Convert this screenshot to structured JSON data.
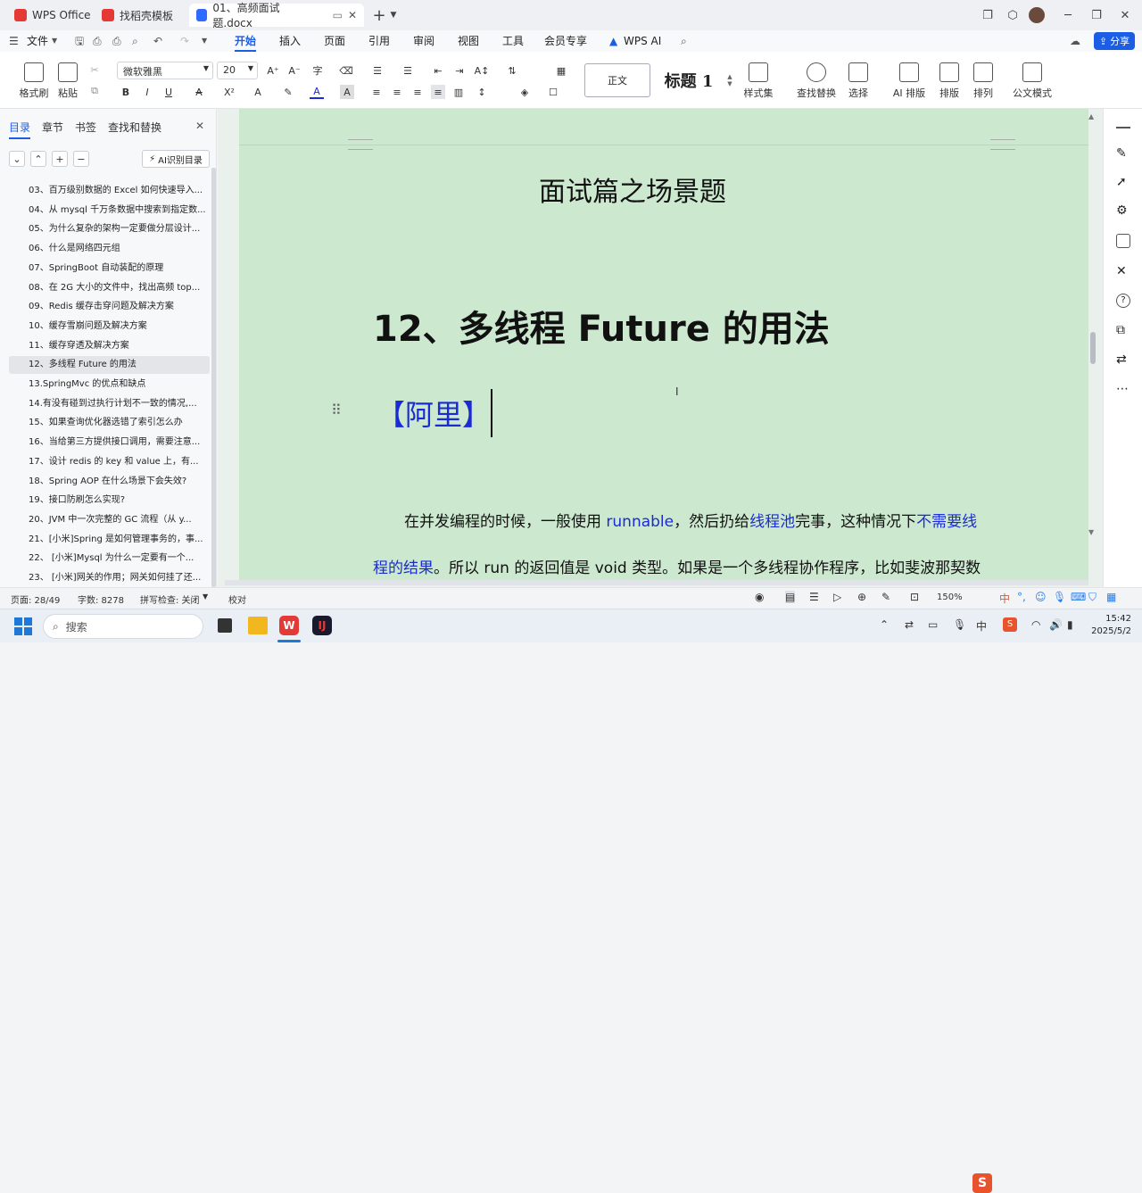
{
  "titlebar": {
    "tabs": [
      {
        "label": "WPS Office",
        "color": "#e53935"
      },
      {
        "label": "找稻壳模板",
        "color": "#e53935"
      },
      {
        "label": "01、高频面试题.docx",
        "color": "#2f6bff"
      }
    ],
    "new_tab": "+"
  },
  "menubar": {
    "file": "文件",
    "items": [
      "开始",
      "插入",
      "页面",
      "引用",
      "审阅",
      "视图",
      "工具",
      "会员专享"
    ],
    "wps_ai": "WPS AI",
    "share": "分享",
    "accent": "#1b5ee5"
  },
  "ribbon": {
    "format_painter": "格式刷",
    "paste": "粘贴",
    "font_name": "微软雅黑",
    "font_size": "20",
    "style_normal": "正文",
    "style_heading": "标题 1",
    "style_set": "样式集",
    "find_replace": "查找替换",
    "select": "选择",
    "ai_layout": "AI 排版",
    "layout": "排版",
    "arrange": "排列",
    "official_mode": "公文模式"
  },
  "leftpanel": {
    "tabs": [
      "目录",
      "章节",
      "书签",
      "查找和替换"
    ],
    "ai_toc": "AI识别目录",
    "toc": [
      "03、百万级别数据的 Excel 如何快速导入...",
      "04、从 mysql 千万条数据中搜索到指定数...",
      "05、为什么复杂的架构一定要做分层设计...",
      "06、什么是网络四元组",
      "07、SpringBoot 自动装配的原理",
      "08、在 2G 大小的文件中，找出高频 top...",
      "09、Redis 缓存击穿问题及解决方案",
      "10、缓存雪崩问题及解决方案",
      "11、缓存穿透及解决方案",
      "12、多线程 Future 的用法",
      "13.SpringMvc 的优点和缺点",
      "14.有没有碰到过执行计划不一致的情况,...",
      "15、如果查询优化器选错了索引怎么办",
      "16、当给第三方提供接口调用，需要注意...",
      "17、设计 redis 的 key 和 value 上，有...",
      "18、Spring AOP 在什么场景下会失效?",
      "19、接口防刷怎么实现?",
      "20、JVM 中一次完整的 GC 流程（从 y...",
      "21、[小米]Spring 是如何管理事务的，事...",
      "22、 [小米]Mysql 为什么一定要有一个...",
      "23、 [小米]网关的作用；网关如何挂了还..."
    ],
    "active_index": 9
  },
  "document": {
    "section_title": "面试篇之场景题",
    "heading": "12、多线程 Future 的用法",
    "tag": "【阿里】",
    "para1": [
      {
        "t": "在并发编程的时候，一般使用 ",
        "c": "#111111"
      },
      {
        "t": "runnable",
        "c": "#1a2bd6"
      },
      {
        "t": "，然后扔给",
        "c": "#111111"
      },
      {
        "t": "线程池",
        "c": "#1a2bd6"
      },
      {
        "t": "完事，这种情况下",
        "c": "#111111"
      },
      {
        "t": "不需要线",
        "c": "#1a2bd6"
      }
    ],
    "para2": [
      {
        "t": "程的结果",
        "c": "#1a2bd6"
      },
      {
        "t": "。所以 run 的返回值是 void 类型。如果是一个多线程协作程序，比如斐波那契数",
        "c": "#111111"
      }
    ],
    "page_bg": "#cce8cf"
  },
  "statusbar": {
    "page": "页面: 28/49",
    "words": "字数: 8278",
    "spell": "拼写检查: 关闭",
    "proof": "校对",
    "zoom": "150%"
  },
  "taskbar": {
    "search": "搜索",
    "time": "15:42",
    "date": "2025/5/2",
    "ime": "中"
  }
}
